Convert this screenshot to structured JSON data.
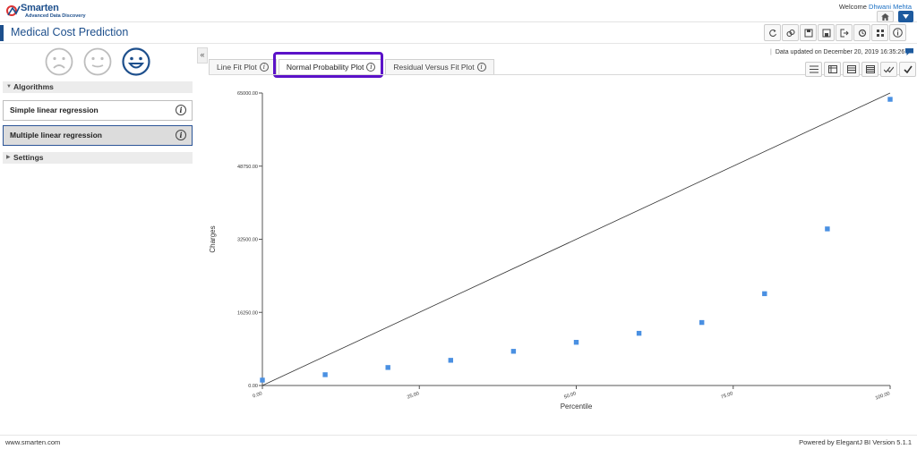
{
  "header": {
    "logo_title": "Smarten",
    "logo_subtitle": "Advanced Data Discovery",
    "welcome_text": "Welcome",
    "user_name": "Dhwani Mehta"
  },
  "page": {
    "title": "Medical Cost Prediction"
  },
  "toolbar": {
    "icons": [
      "refresh-icon",
      "link-icon",
      "save-icon",
      "save-as-icon",
      "export-icon",
      "publish-icon",
      "layout-icon",
      "info-icon"
    ]
  },
  "sidebar": {
    "algorithms_label": "Algorithms",
    "settings_label": "Settings",
    "items": [
      {
        "label": "Simple linear regression",
        "selected": false
      },
      {
        "label": "Multiple linear regression",
        "selected": true
      }
    ],
    "faces": [
      "sad-face-icon",
      "neutral-face-icon",
      "happy-face-icon"
    ]
  },
  "status": {
    "updated_text": "Data updated on December 20, 2019 16:35:26"
  },
  "tabs": [
    {
      "label": "Line Fit Plot",
      "active": false
    },
    {
      "label": "Normal Probability Plot",
      "active": true
    },
    {
      "label": "Residual Versus Fit Plot",
      "active": false
    }
  ],
  "colors": {
    "brand": "#1d4f8c",
    "highlight": "#5b12c8",
    "point": "#4a90e2"
  },
  "chart_data": {
    "type": "scatter",
    "xlabel": "Percentile",
    "ylabel": "Charges",
    "xlim": [
      0,
      100
    ],
    "ylim": [
      0,
      65000
    ],
    "x_ticks": [
      "0.00",
      "25.00",
      "50.00",
      "75.00",
      "100.00"
    ],
    "y_ticks": [
      "0.00",
      "16250.00",
      "32500.00",
      "48750.00",
      "65000.00"
    ],
    "points": [
      {
        "x": 0,
        "y": 1200
      },
      {
        "x": 10,
        "y": 2400
      },
      {
        "x": 20,
        "y": 4000
      },
      {
        "x": 30,
        "y": 5600
      },
      {
        "x": 40,
        "y": 7600
      },
      {
        "x": 50,
        "y": 9600
      },
      {
        "x": 60,
        "y": 11600
      },
      {
        "x": 70,
        "y": 14000
      },
      {
        "x": 80,
        "y": 20400
      },
      {
        "x": 90,
        "y": 34800
      },
      {
        "x": 100,
        "y": 63600
      }
    ],
    "trend_line": {
      "x": [
        0,
        100
      ],
      "y": [
        0,
        65000
      ]
    },
    "grid": false
  },
  "footer": {
    "left": "www.smarten.com",
    "right": "Powered by ElegantJ BI Version 5.1.1"
  }
}
